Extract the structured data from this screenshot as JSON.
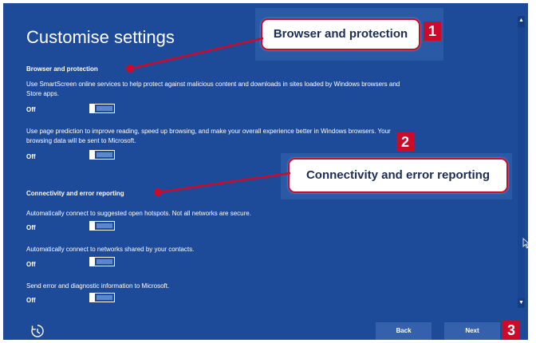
{
  "page": {
    "title": "Customise settings"
  },
  "sections": {
    "browser": {
      "heading": "Browser and protection",
      "settings": [
        {
          "description": "Use SmartScreen online services to help protect against malicious content and downloads in sites loaded by Windows browsers and Store apps.",
          "state": "Off"
        },
        {
          "description": "Use page prediction to improve reading, speed up browsing, and make your overall experience better in Windows browsers. Your browsing data will be sent to Microsoft.",
          "state": "Off"
        }
      ]
    },
    "connectivity": {
      "heading": "Connectivity and error reporting",
      "settings": [
        {
          "description": "Automatically connect to suggested open hotspots. Not all networks are secure.",
          "state": "Off"
        },
        {
          "description": "Automatically connect to networks shared by your contacts.",
          "state": "Off"
        },
        {
          "description": "Send error and diagnostic information to Microsoft.",
          "state": "Off"
        }
      ]
    }
  },
  "buttons": {
    "back": "Back",
    "next": "Next"
  },
  "callouts": {
    "one": {
      "label": "Browser and protection",
      "number": "1"
    },
    "two": {
      "label": "Connectivity and error reporting",
      "number": "2"
    },
    "three": {
      "number": "3"
    }
  },
  "colors": {
    "background": "#1d4a99",
    "accent": "#cc0a2a",
    "button": "#3561ac"
  },
  "icons": {
    "ease_of_access": "ease-of-access-icon"
  }
}
